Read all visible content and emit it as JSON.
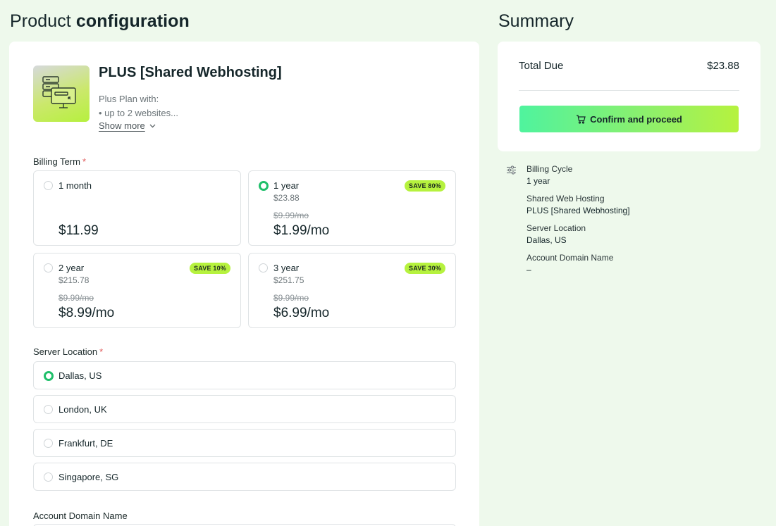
{
  "header": {
    "title_prefix": "Product",
    "title_bold": "configuration",
    "summary_title": "Summary"
  },
  "product": {
    "name": "PLUS [Shared Webhosting]",
    "desc_line1": "Plus Plan with:",
    "desc_line2": "• up to 2 websites...",
    "show_more": "Show more"
  },
  "billing": {
    "label": "Billing Term",
    "required_mark": "*",
    "options": [
      {
        "name": "1 month",
        "total": "",
        "old": "",
        "price": "$11.99",
        "badge": "",
        "selected": false
      },
      {
        "name": "1 year",
        "total": "$23.88",
        "old": "$9.99/mo",
        "price": "$1.99/mo",
        "badge": "SAVE 80%",
        "selected": true
      },
      {
        "name": "2 year",
        "total": "$215.78",
        "old": "$9.99/mo",
        "price": "$8.99/mo",
        "badge": "SAVE 10%",
        "selected": false
      },
      {
        "name": "3 year",
        "total": "$251.75",
        "old": "$9.99/mo",
        "price": "$6.99/mo",
        "badge": "SAVE 30%",
        "selected": false
      }
    ]
  },
  "location": {
    "label": "Server Location",
    "required_mark": "*",
    "options": [
      {
        "name": "Dallas, US",
        "selected": true
      },
      {
        "name": "London, UK",
        "selected": false
      },
      {
        "name": "Frankfurt, DE",
        "selected": false
      },
      {
        "name": "Singapore, SG",
        "selected": false
      }
    ]
  },
  "domain": {
    "label": "Account Domain Name"
  },
  "summary": {
    "total_label": "Total Due",
    "total_value": "$23.88",
    "confirm_label": "Confirm and proceed",
    "details": [
      {
        "label": "Billing Cycle",
        "value": "1 year"
      },
      {
        "label": "Shared Web Hosting",
        "value": "PLUS [Shared Webhosting]"
      },
      {
        "label": "Server Location",
        "value": "Dallas, US"
      },
      {
        "label": "Account Domain Name",
        "value": "–"
      }
    ]
  },
  "colors": {
    "background": "#eef9ec",
    "accent_green": "#1fbf6a",
    "badge_lime": "#b6f23e",
    "required_red": "#e05a5a"
  },
  "icons": {
    "product": "server-monitor-icon",
    "show_more": "chevron-down-icon",
    "confirm": "cart-icon",
    "details": "sliders-icon"
  }
}
